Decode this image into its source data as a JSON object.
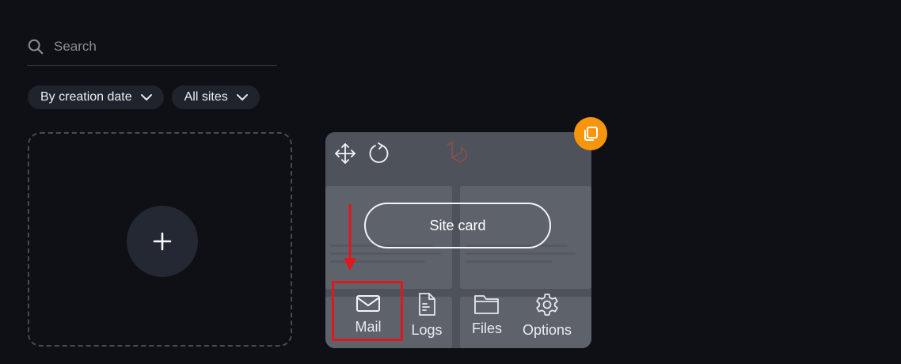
{
  "search": {
    "placeholder": "Search",
    "value": ""
  },
  "filters": [
    {
      "label": "By creation date"
    },
    {
      "label": "All sites"
    }
  ],
  "site_card": {
    "button_label": "Site card",
    "actions": [
      {
        "label": "Mail",
        "icon": "mail-icon"
      },
      {
        "label": "Logs",
        "icon": "document-icon"
      },
      {
        "label": "Files",
        "icon": "folder-icon"
      },
      {
        "label": "Options",
        "icon": "gear-icon"
      }
    ]
  },
  "colors": {
    "background": "#0f1015",
    "card": "#4e525b",
    "badge": "#f7960c",
    "highlight": "#e0181c"
  }
}
